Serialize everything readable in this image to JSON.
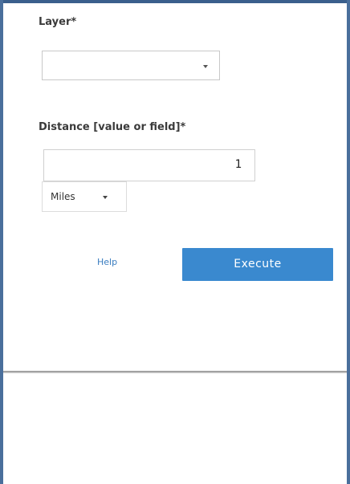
{
  "form": {
    "layer_label": "Layer*",
    "layer_selected": "",
    "distance_label": "Distance [value or field]*",
    "distance_value": "1",
    "units_selected": "Miles",
    "help_link": "Help",
    "execute_button": "Execute"
  },
  "colors": {
    "accent": "#3a89cf",
    "link": "#3a7dc0",
    "frame": "#3a5f8c"
  }
}
